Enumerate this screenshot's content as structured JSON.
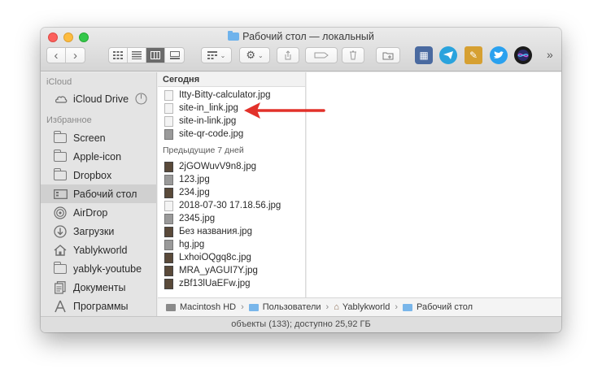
{
  "window": {
    "title": "Рабочий стол — локальный",
    "status": "объекты (133); доступно 25,92 ГБ"
  },
  "toolbar": {
    "back": "‹",
    "forward": "›",
    "more": "»"
  },
  "sidebar": {
    "icloud_header": "iCloud",
    "icloud_drive": "iCloud Drive",
    "favorites_header": "Избранное",
    "items": [
      {
        "label": "Screen",
        "icon": "folder-icon"
      },
      {
        "label": "Apple-icon",
        "icon": "folder-icon"
      },
      {
        "label": "Dropbox",
        "icon": "folder-icon"
      },
      {
        "label": "Рабочий стол",
        "icon": "desktop-icon"
      },
      {
        "label": "AirDrop",
        "icon": "airdrop-icon"
      },
      {
        "label": "Загрузки",
        "icon": "downloads-icon"
      },
      {
        "label": "Yablykworld",
        "icon": "home-icon"
      },
      {
        "label": "yablyk-youtube",
        "icon": "folder-icon"
      },
      {
        "label": "Документы",
        "icon": "documents-icon"
      },
      {
        "label": "Программы",
        "icon": "applications-icon"
      }
    ]
  },
  "column": {
    "today_header": "Сегодня",
    "today_files": [
      "Itty-Bitty-calculator.jpg",
      "site-in_link.jpg",
      "site-in-link.jpg",
      "site-qr-code.jpg"
    ],
    "week_header": "Предыдущие 7 дней",
    "week_files": [
      "2jGOWuvV9n8.jpg",
      "123.jpg",
      "234.jpg",
      "2018-07-30 17.18.56.jpg",
      "2345.jpg",
      "Без названия.jpg",
      "hg.jpg",
      "LxhoiOQgq8c.jpg",
      "MRA_yAGUI7Y.jpg",
      "zBf13lUaEFw.jpg"
    ]
  },
  "pathbar": {
    "items": [
      "Macintosh HD",
      "Пользователи",
      "Yablykworld",
      "Рабочий стол"
    ]
  },
  "colors": {
    "arrow": "#e2312a",
    "selected_sidebar": "#d0d0d0"
  }
}
